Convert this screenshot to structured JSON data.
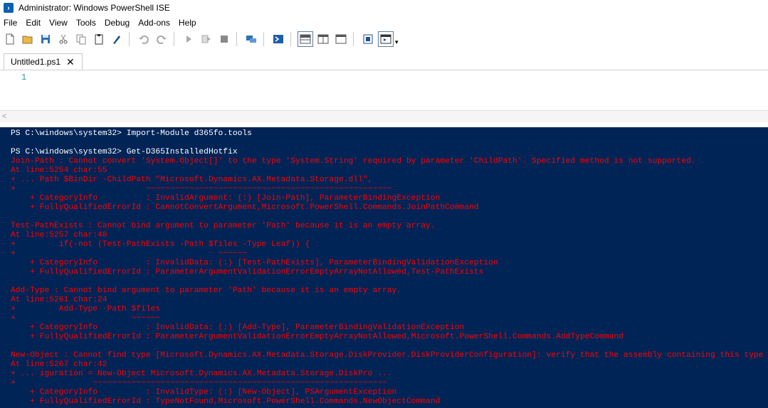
{
  "window": {
    "title": "Administrator: Windows PowerShell ISE"
  },
  "menu": [
    "File",
    "Edit",
    "View",
    "Tools",
    "Debug",
    "Add-ons",
    "Help"
  ],
  "toolbar": {
    "icons": [
      "new-icon",
      "open-icon",
      "save-icon",
      "cut-icon",
      "copy-icon",
      "paste-icon",
      "clear-icon",
      "undo-icon",
      "redo-icon",
      "run-icon",
      "run-selection-icon",
      "stop-icon",
      "remote-icon",
      "powershell-icon",
      "layout-top-icon",
      "layout-right-icon",
      "layout-max-icon",
      "command-icon",
      "addon-icon"
    ],
    "overflow": "▾"
  },
  "tabs": [
    {
      "label": "Untitled1.ps1",
      "close": "✕"
    }
  ],
  "editor": {
    "line_numbers": [
      "1"
    ]
  },
  "console": {
    "lines": [
      {
        "text": "PS C:\\windows\\system32> Import-Module d365fo.tools",
        "kind": "out"
      },
      {
        "text": "",
        "kind": "out"
      },
      {
        "text": "PS C:\\windows\\system32> Get-D365InstalledHotfix",
        "kind": "out"
      },
      {
        "text": "Join-Path : Cannot convert 'System.Object[]' to the type 'System.String' required by parameter 'ChildPath'. Specified method is not supported.",
        "kind": "err"
      },
      {
        "text": "At line:5254 char:55",
        "kind": "err"
      },
      {
        "text": "+ ... Path $BinDir -ChildPath \"Microsoft.Dynamics.AX.Metadata.Storage.dll\",",
        "kind": "err"
      },
      {
        "text": "+                           ~~~~~~~~~~~~~~~~~~~~~~~~~~~~~~~~~~~~~~~~~~~~~~~~~~~",
        "kind": "err"
      },
      {
        "text": "    + CategoryInfo          : InvalidArgument: (:) [Join-Path], ParameterBindingException",
        "kind": "err"
      },
      {
        "text": "    + FullyQualifiedErrorId : CannotConvertArgument,Microsoft.PowerShell.Commands.JoinPathCommand",
        "kind": "err"
      },
      {
        "text": "",
        "kind": "err"
      },
      {
        "text": "Test-PathExists : Cannot bind argument to parameter 'Path' because it is an empty array.",
        "kind": "err"
      },
      {
        "text": "At line:5257 char:40",
        "kind": "err"
      },
      {
        "text": "+         if(-not (Test-PathExists -Path $files -Type Leaf)) {",
        "kind": "err"
      },
      {
        "text": "+                                          ~~~~~~",
        "kind": "err"
      },
      {
        "text": "    + CategoryInfo          : InvalidData: (:) [Test-PathExists], ParameterBindingValidationException",
        "kind": "err"
      },
      {
        "text": "    + FullyQualifiedErrorId : ParameterArgumentValidationErrorEmptyArrayNotAllowed,Test-PathExists",
        "kind": "err"
      },
      {
        "text": "",
        "kind": "err"
      },
      {
        "text": "Add-Type : Cannot bind argument to parameter 'Path' because it is an empty array.",
        "kind": "err"
      },
      {
        "text": "At line:5261 char:24",
        "kind": "err"
      },
      {
        "text": "+         Add-Type -Path $files",
        "kind": "err"
      },
      {
        "text": "+                        ~~~~~~",
        "kind": "err"
      },
      {
        "text": "    + CategoryInfo          : InvalidData: (:) [Add-Type], ParameterBindingValidationException",
        "kind": "err"
      },
      {
        "text": "    + FullyQualifiedErrorId : ParameterArgumentValidationErrorEmptyArrayNotAllowed,Microsoft.PowerShell.Commands.AddTypeCommand",
        "kind": "err"
      },
      {
        "text": "",
        "kind": "err"
      },
      {
        "text": "New-Object : Cannot find type [Microsoft.Dynamics.AX.Metadata.Storage.DiskProvider.DiskProviderConfiguration]: verify that the assembly containing this type is loaded.",
        "kind": "err"
      },
      {
        "text": "At line:5267 char:42",
        "kind": "err"
      },
      {
        "text": "+ ... iguration = New-Object Microsoft.Dynamics.AX.Metadata.Storage.DiskPro ...",
        "kind": "err"
      },
      {
        "text": "+                ~~~~~~~~~~~~~~~~~~~~~~~~~~~~~~~~~~~~~~~~~~~~~~~~~~~~~~~~~~~~~",
        "kind": "err"
      },
      {
        "text": "    + CategoryInfo          : InvalidType: (:) [New-Object], PSArgumentException",
        "kind": "err"
      },
      {
        "text": "    + FullyQualifiedErrorId : TypeNotFound,Microsoft.PowerShell.Commands.NewObjectCommand",
        "kind": "err"
      }
    ]
  },
  "colors": {
    "console_bg": "#012456",
    "error": "#ff0000",
    "output": "#ffffff",
    "line_number": "#2b91af"
  }
}
